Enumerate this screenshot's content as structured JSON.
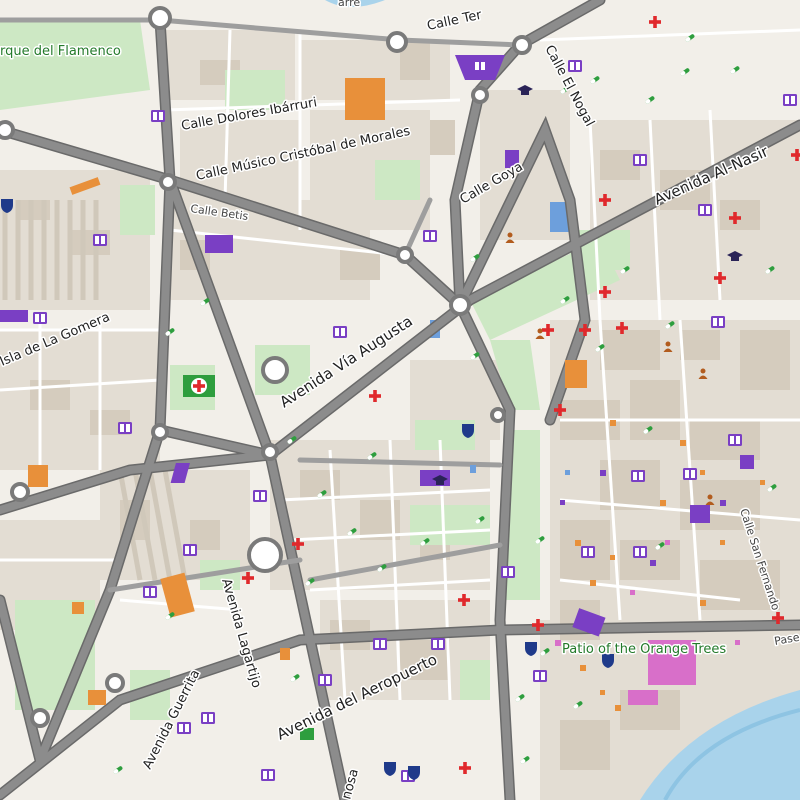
{
  "map": {
    "labels": {
      "parque_flamenco": "rque del Flamenco",
      "calle_ter": "Calle Ter",
      "calle_dolores": "Calle Dolores Ibárruri",
      "calle_musico": "Calle Músico Cristóbal de Morales",
      "calle_el_nogal": "Calle El Nogal",
      "calle_goya": "Calle Goya",
      "avenida_al_nasir": "Avenida Al-Nasir",
      "calle_betis": "Calle Betis",
      "isla_gomera": "Isla de La Gomera",
      "avenida_via_augusta": "Avenida Vía Augusta",
      "calle_san_fernando": "Calle San Fernando",
      "avenida_lagartijo": "Avenida Lagartijo",
      "patio_orange_trees": "Patio of the Orange Trees",
      "avenida_guerrita": "Avenida Guerrita",
      "avenida_aeropuerto": "Avenida del Aeropuerto",
      "pase": "Pase",
      "nosa": "nosa",
      "top_frag": "arre"
    },
    "colors": {
      "background": "#f2efe9",
      "road_major": "#7a7a7a",
      "road_minor": "#ffffff",
      "block": "#dcd5c9",
      "building": "#cfc6b8",
      "park": "#cde8c4",
      "water": "#a9d3eb",
      "poi_purple": "#7a3fc4",
      "poi_orange": "#e8903a",
      "poi_pink": "#d86fc9",
      "poi_red": "#e0292c",
      "poi_green": "#2e9e3e",
      "poi_navy": "#1f3a8a"
    },
    "icons": {
      "library": "library-icon",
      "pharmacy": "pharmacy-icon",
      "hospital": "hospital-icon",
      "police": "police-icon",
      "university": "university-icon",
      "person": "person-icon"
    }
  }
}
